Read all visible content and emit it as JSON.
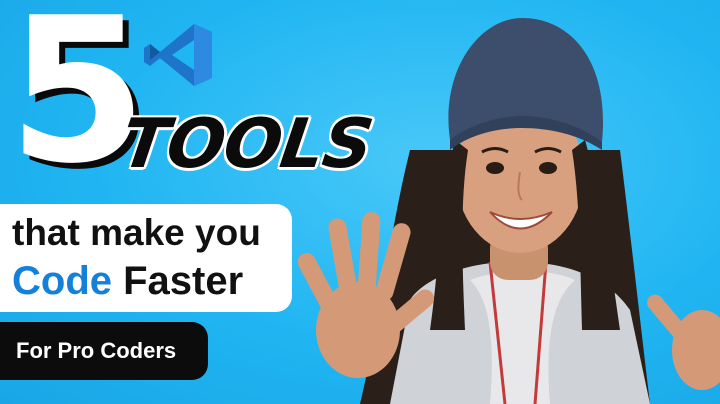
{
  "thumbnail": {
    "number": "5",
    "word": "TOOLS",
    "tagline_line1": "that make you",
    "tagline_code": "Code",
    "tagline_faster": "Faster",
    "badge": "For Pro Coders"
  },
  "icons": {
    "logo": "vscode-logo-icon"
  },
  "colors": {
    "background": "#1fb6f4",
    "accent_blue": "#1580d8",
    "text_dark": "#111111",
    "white": "#ffffff",
    "hat": "#3c4e6c"
  }
}
